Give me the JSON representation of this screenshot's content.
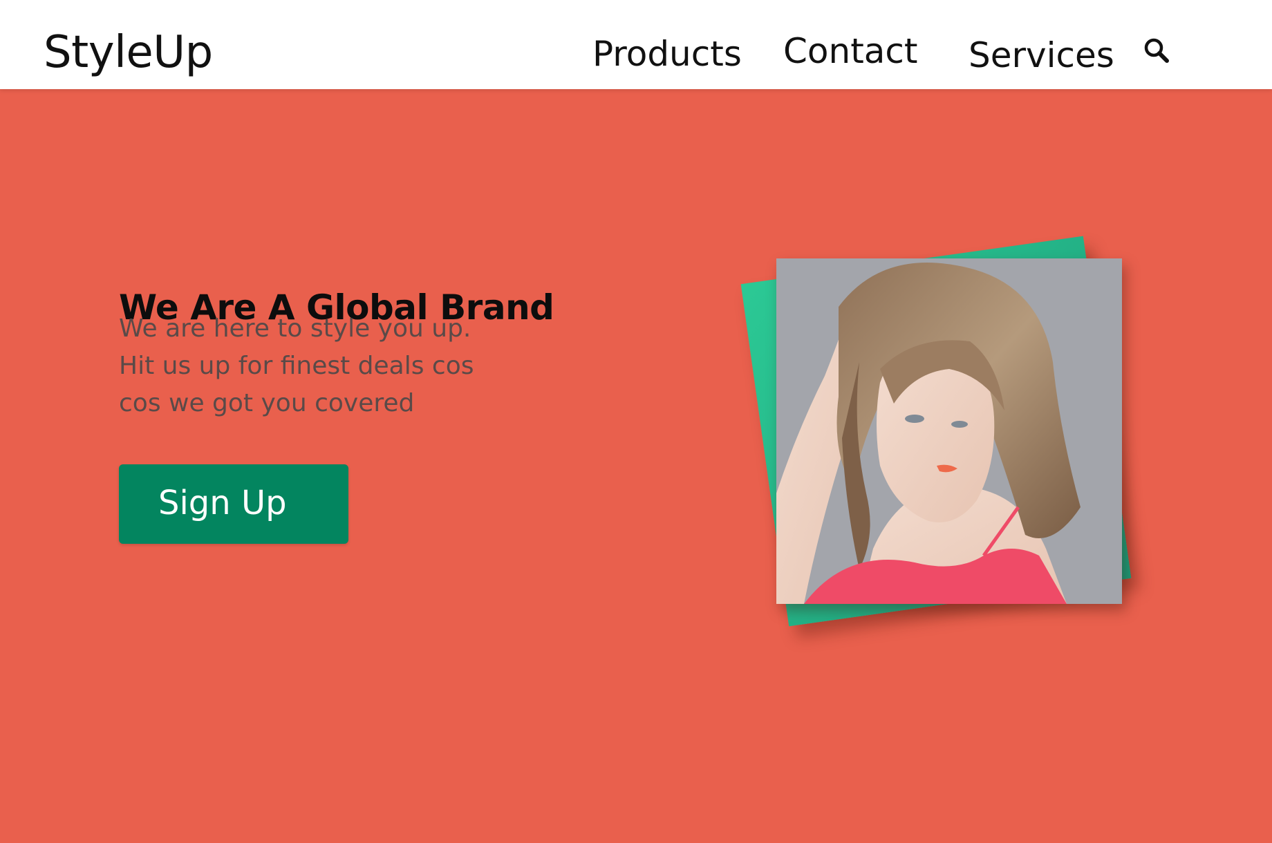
{
  "header": {
    "logo": "StyleUp",
    "nav": [
      {
        "label": "Products"
      },
      {
        "label": "Contact"
      },
      {
        "label": "Services"
      }
    ],
    "search_icon": "search-icon"
  },
  "hero": {
    "headline": "We Are A Global Brand",
    "description_lines": [
      "We are here to style you up.",
      "Hit us up for finest deals cos",
      "cos we got you covered"
    ],
    "signup_label": "Sign Up",
    "image": "fashion-model-photo"
  },
  "colors": {
    "background": "#e9604d",
    "button": "#03855f",
    "card_accent": "#2cc995",
    "topbar": "#ffffff"
  }
}
